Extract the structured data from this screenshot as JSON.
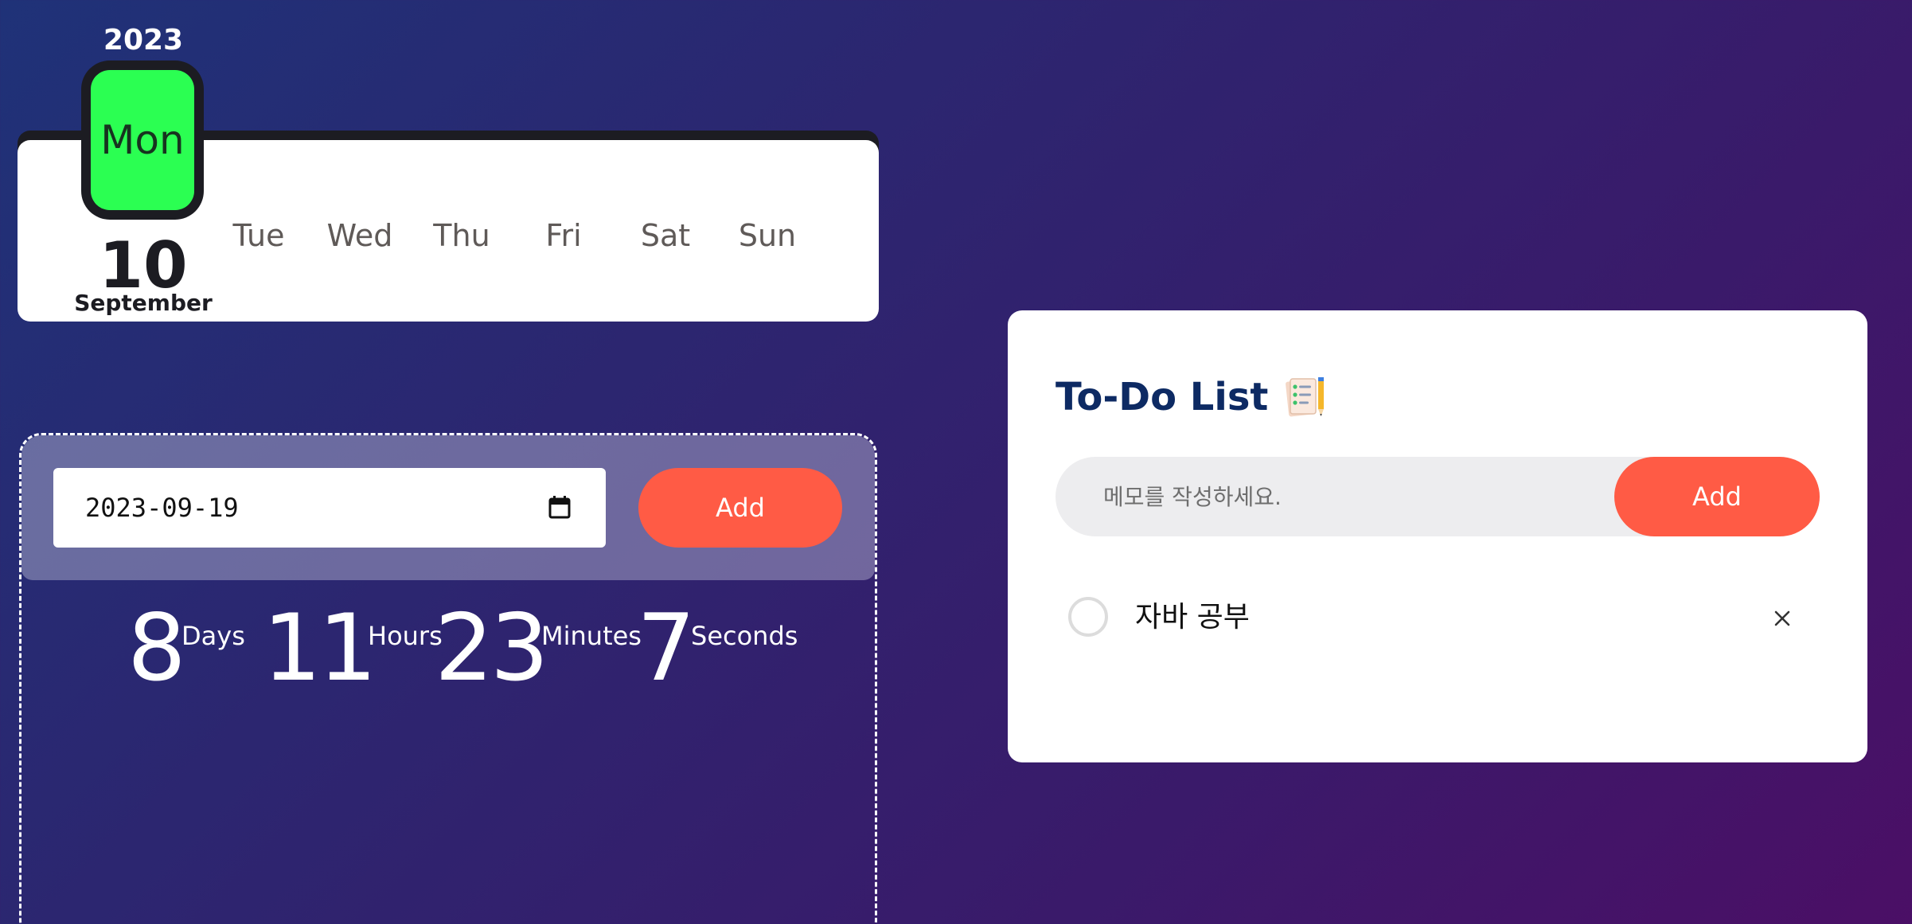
{
  "calendar": {
    "year": "2023",
    "today_weekday": "Mon",
    "date": "10",
    "month": "September",
    "other_days": [
      "Tue",
      "Wed",
      "Thu",
      "Fri",
      "Sat",
      "Sun"
    ],
    "highlight_color": "#2bff52"
  },
  "dday": {
    "date_value": "2023-09-19",
    "add_label": "Add",
    "countdown": {
      "days": "8",
      "days_label": "Days",
      "hours": "11",
      "hours_label": "Hours",
      "minutes": "23",
      "minutes_label": "Minutes",
      "seconds": "7",
      "seconds_label": "Seconds"
    }
  },
  "todo": {
    "title": "To-Do List",
    "title_icon": "notepad-pencil-icon",
    "placeholder": "메모를 작성하세요.",
    "add_label": "Add",
    "items": [
      {
        "text": "자바 공부",
        "done": false
      }
    ]
  },
  "colors": {
    "accent": "#ff5b45",
    "title": "#0d2a63"
  }
}
